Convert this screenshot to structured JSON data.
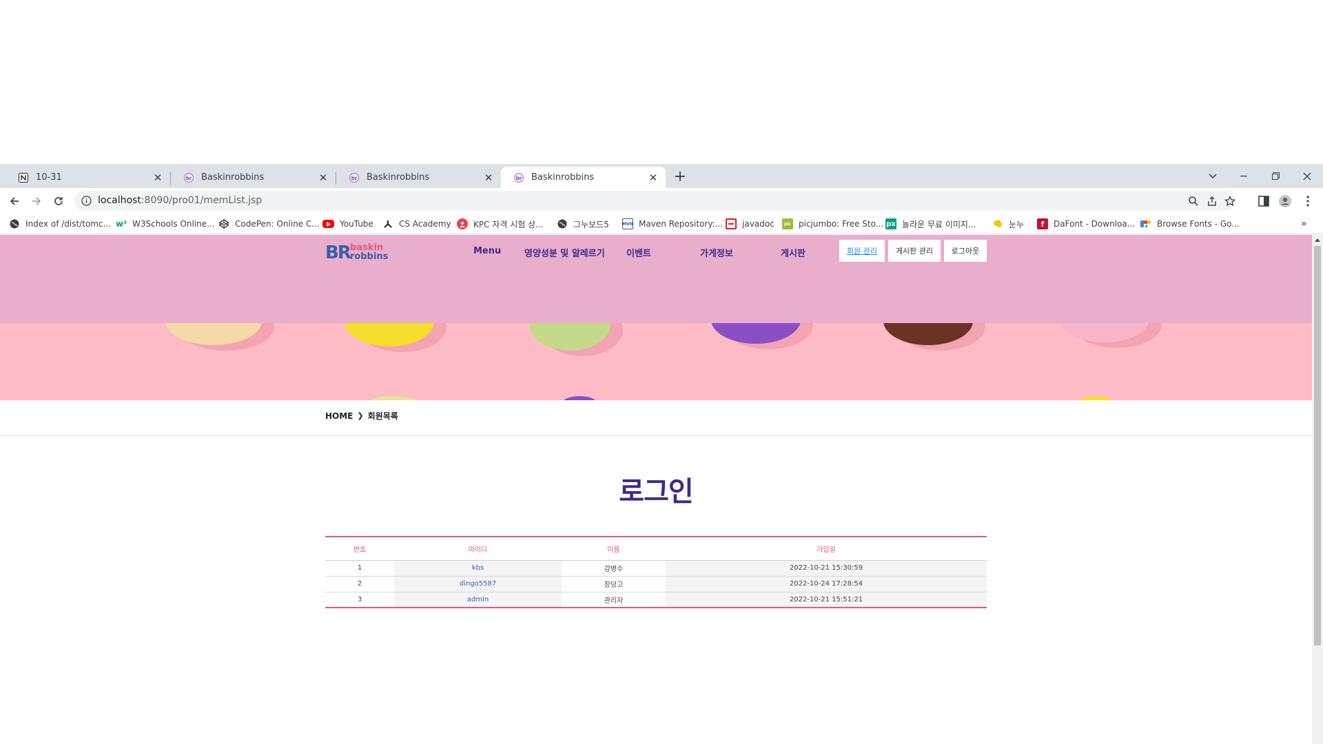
{
  "browser": {
    "tabs": [
      {
        "title": "10-31",
        "icon": "notion-icon",
        "active": false
      },
      {
        "title": "Baskinrobbins",
        "icon": "baskinrobbins-favicon",
        "active": false
      },
      {
        "title": "Baskinrobbins",
        "icon": "baskinrobbins-favicon",
        "active": false
      },
      {
        "title": "Baskinrobbins",
        "icon": "baskinrobbins-favicon",
        "active": true
      }
    ],
    "url_host": "localhost",
    "url_rest": ":8090/pro01/memList.jsp",
    "bookmarks": [
      {
        "label": "Index of /dist/tomc...",
        "icon": "globe-icon"
      },
      {
        "label": "W3Schools Online...",
        "icon": "w3schools-icon"
      },
      {
        "label": "CodePen: Online C...",
        "icon": "codepen-icon"
      },
      {
        "label": "YouTube",
        "icon": "youtube-icon"
      },
      {
        "label": "CS Academy",
        "icon": "cs-academy-icon"
      },
      {
        "label": "KPC 자격 시험 상...",
        "icon": "kpc-icon"
      },
      {
        "label": "그누보드5",
        "icon": "globe-icon"
      },
      {
        "label": "Maven Repository:...",
        "icon": "maven-icon"
      },
      {
        "label": "javadoc",
        "icon": "javadoc-icon"
      },
      {
        "label": "picjumbo: Free Sto...",
        "icon": "picjumbo-icon"
      },
      {
        "label": "놀라운 무료 이미지...",
        "icon": "pexels-icon"
      },
      {
        "label": "눈누",
        "icon": "noonnu-icon"
      },
      {
        "label": "DaFont - Downloa...",
        "icon": "dafont-icon"
      },
      {
        "label": "Browse Fonts - Go...",
        "icon": "google-fonts-icon"
      }
    ],
    "bookmarks_overflow": "»"
  },
  "site": {
    "logo_text_top": "baskin",
    "logo_text_bottom": "robbins",
    "logo_br": "BR",
    "nav": [
      "Menu",
      "영양성분 및 알레르기",
      "이벤트",
      "가게정보",
      "게시판"
    ],
    "top_buttons": [
      {
        "label": "회원 관리",
        "active": true
      },
      {
        "label": "게시판 관리",
        "active": false
      },
      {
        "label": "로그아웃",
        "active": false
      }
    ],
    "breadcrumb_home": "HOME",
    "breadcrumb_sep": "❯",
    "breadcrumb_current": "회원목록",
    "page_title": "로그인",
    "colors": {
      "header": "#e8aecb",
      "hero": "#fdbcc5",
      "title": "#3d2a8a",
      "accent": "#e2587c"
    }
  },
  "table": {
    "headers": [
      "번호",
      "아이디",
      "이름",
      "가입일"
    ],
    "rows": [
      [
        "1",
        "kbs",
        "강병수",
        "2022-10-21 15:30:59"
      ],
      [
        "2",
        "dingo5587",
        "장덩고",
        "2022-10-24 17:28:54"
      ],
      [
        "3",
        "admin",
        "관리자",
        "2022-10-21 15:51:21"
      ]
    ]
  }
}
